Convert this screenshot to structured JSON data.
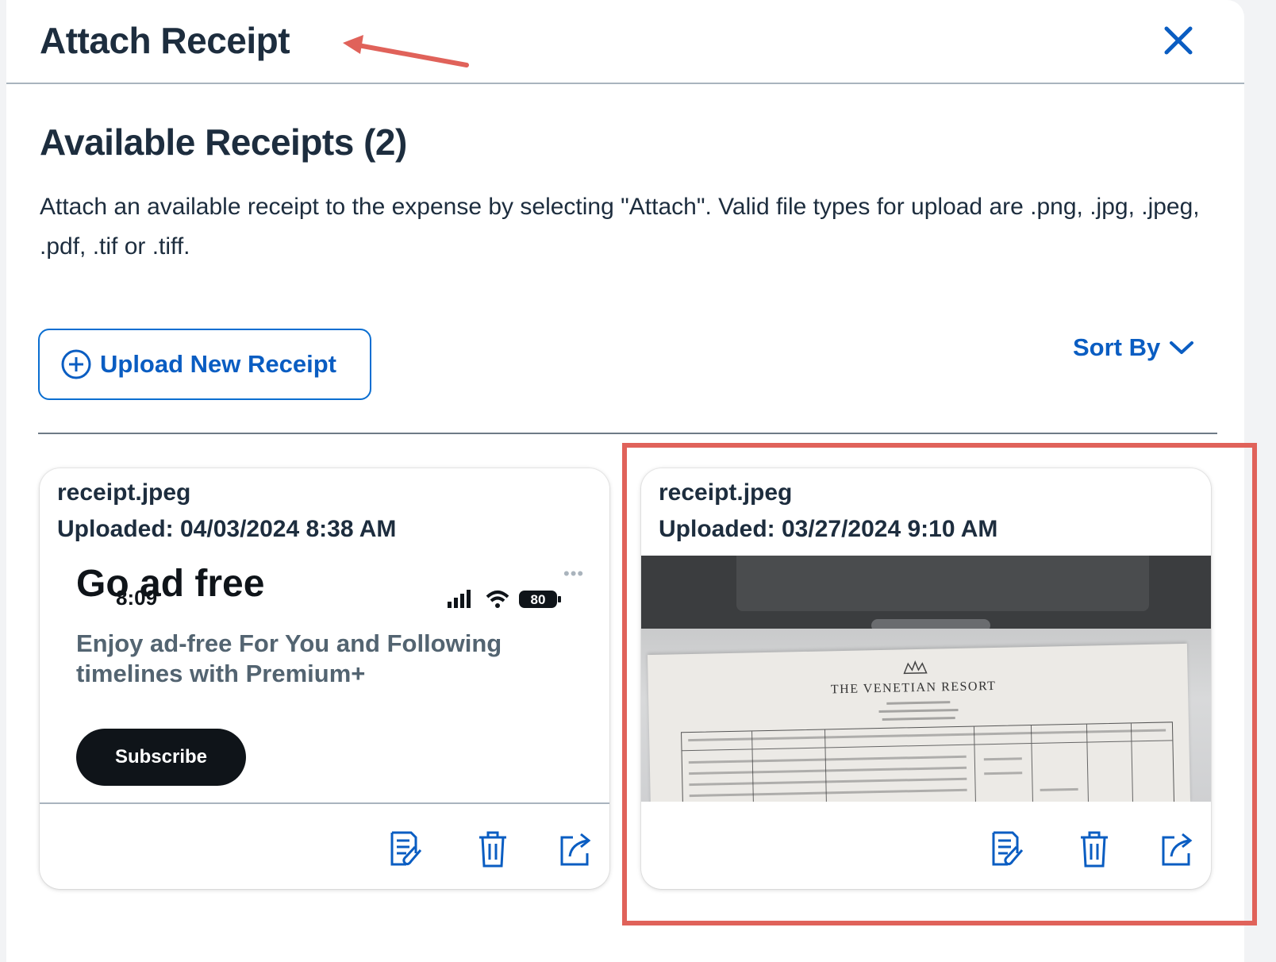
{
  "dialog": {
    "title": "Attach Receipt",
    "close_icon": "close-icon"
  },
  "section": {
    "title": "Available Receipts (2)",
    "description": "Attach an available receipt to the expense by selecting \"Attach\". Valid file types for upload are .png, .jpg, .jpeg, .pdf, .tif or .tiff."
  },
  "toolbar": {
    "upload_label": "Upload New Receipt",
    "upload_icon": "plus-circle-icon",
    "sort_label": "Sort By",
    "sort_icon": "chevron-down-icon"
  },
  "receipts": [
    {
      "file_name": "receipt.jpeg",
      "uploaded": "Uploaded: 04/03/2024 8:38 AM",
      "preview": {
        "headline": "Go ad free",
        "clock": "8:09",
        "battery": "80",
        "subtext": "Enjoy ad-free For You and Following timelines with Premium+",
        "button": "Subscribe"
      },
      "actions": [
        "attach-receipt-icon",
        "delete-icon",
        "open-external-icon"
      ]
    },
    {
      "file_name": "receipt.jpeg",
      "uploaded": "Uploaded: 03/27/2024 9:10 AM",
      "preview": {
        "resort_name": "THE VENETIAN RESORT"
      },
      "actions": [
        "attach-receipt-icon",
        "delete-icon",
        "open-external-icon"
      ]
    }
  ],
  "colors": {
    "accent": "#0a5dc2",
    "annotation": "#e0625a",
    "text": "#1d2d3e"
  }
}
